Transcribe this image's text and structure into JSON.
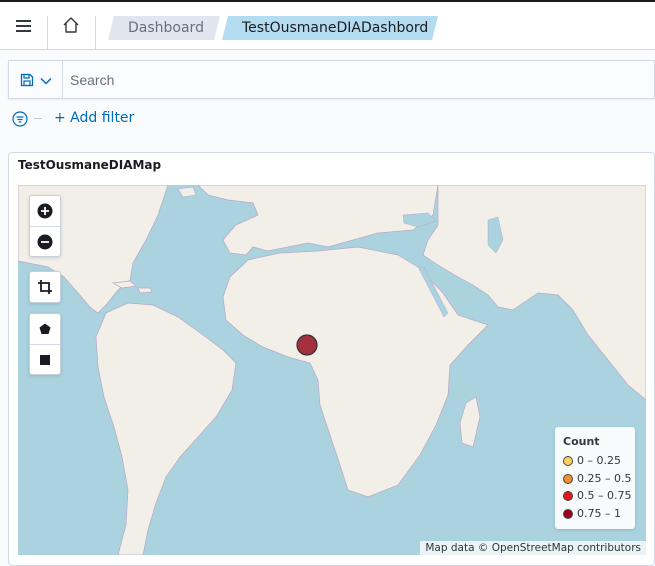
{
  "header": {
    "breadcrumbs": [
      {
        "label": "Dashboard"
      },
      {
        "label": "TestOusmaneDIADashbord"
      }
    ]
  },
  "query": {
    "search_placeholder": "Search",
    "add_filter_label": "+ Add filter"
  },
  "panel": {
    "title": "TestOusmaneDIAMap",
    "map": {
      "marker_color": "#a3303f",
      "legend": {
        "title": "Count",
        "items": [
          {
            "label": "0 – 0.25",
            "color": "#fdd05a"
          },
          {
            "label": "0.25 – 0.5",
            "color": "#f28e2b"
          },
          {
            "label": "0.5 – 0.75",
            "color": "#e8141c"
          },
          {
            "label": "0.75 – 1",
            "color": "#99001d"
          }
        ]
      },
      "attribution": "Map data © OpenStreetMap contributors"
    }
  }
}
